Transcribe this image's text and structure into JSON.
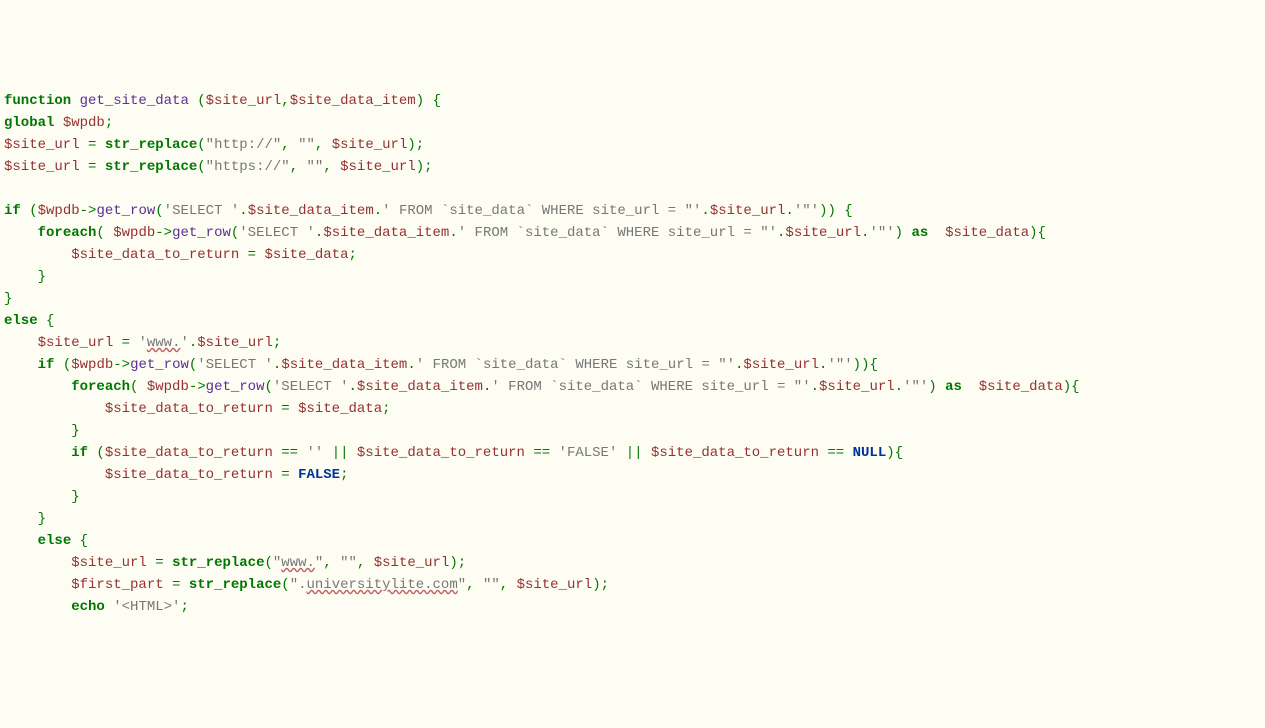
{
  "l1": {
    "kw1": "function",
    "func": "get_site_data",
    "p": " (",
    "v1": "$site_url",
    "c": ",",
    "v2": "$site_data_item",
    "end": ") {"
  },
  "l2": {
    "kw": "global",
    "sp": " ",
    "v": "$wpdb",
    "end": ";"
  },
  "l3": {
    "v1": "$site_url",
    "eq": " = ",
    "fn": "str_replace",
    "p1": "(",
    "s1": "\"http://\"",
    "c1": ", ",
    "s2": "\"\"",
    "c2": ", ",
    "v2": "$site_url",
    "end": ");"
  },
  "l4": {
    "v1": "$site_url",
    "eq": " = ",
    "fn": "str_replace",
    "p1": "(",
    "s1": "\"https://\"",
    "c1": ", ",
    "s2": "\"\"",
    "c2": ", ",
    "v2": "$site_url",
    "end": ");"
  },
  "l6": {
    "kw": "if",
    "sp": " (",
    "v1": "$wpdb",
    "arrow": "->",
    "m": "get_row",
    "p1": "(",
    "s1": "'SELECT '",
    "d1": ".",
    "v2": "$site_data_item",
    "d2": ".",
    "s2": "' FROM `site_data` WHERE site_url = \"'",
    "d3": ".",
    "v3": "$site_url",
    "d4": ".",
    "s3": "'\"'",
    "end": ")) {"
  },
  "l7": {
    "kw": "foreach",
    "p1": "( ",
    "v1": "$wpdb",
    "arrow": "->",
    "m": "get_row",
    "p2": "(",
    "s1": "'SELECT '",
    "d1": ".",
    "v2": "$site_data_item",
    "d2": ".",
    "s2": "' FROM `site_data` WHERE site_url = \"'",
    "d3": ".",
    "v3": "$site_url",
    "d4": ".",
    "s3": "'\"'",
    "p3": ") ",
    "kw2": "as",
    "sp": "  ",
    "v4": "$site_data",
    "end": "){"
  },
  "l8": {
    "v1": "$site_data_to_return",
    "eq": " = ",
    "v2": "$site_data",
    "end": ";"
  },
  "l9": {
    "b": "}"
  },
  "l10": {
    "b": "}"
  },
  "l11": {
    "kw": "else",
    "b": " {"
  },
  "l12": {
    "v1": "$site_url",
    "eq": " = ",
    "s1": "'",
    "s2": "www.",
    "s3": "'",
    "d": ".",
    "v2": "$site_url",
    "end": ";"
  },
  "l13": {
    "kw": "if",
    "sp": " (",
    "v1": "$wpdb",
    "arrow": "->",
    "m": "get_row",
    "p1": "(",
    "s1": "'SELECT '",
    "d1": ".",
    "v2": "$site_data_item",
    "d2": ".",
    "s2": "' FROM `site_data` WHERE site_url = \"'",
    "d3": ".",
    "v3": "$site_url",
    "d4": ".",
    "s3": "'\"'",
    "end": ")){"
  },
  "l14": {
    "kw": "foreach",
    "p1": "( ",
    "v1": "$wpdb",
    "arrow": "->",
    "m": "get_row",
    "p2": "(",
    "s1": "'SELECT '",
    "d1": ".",
    "v2": "$site_data_item",
    "d2": ".",
    "s2": "' FROM `site_data` WHERE site_url = \"'",
    "d3": ".",
    "v3": "$site_url",
    "d4": ".",
    "s3": "'\"'",
    "p3": ") ",
    "kw2": "as",
    "sp": "  ",
    "v4": "$site_data",
    "end": "){"
  },
  "l15": {
    "v1": "$site_data_to_return",
    "eq": " = ",
    "v2": "$site_data",
    "end": ";"
  },
  "l16": {
    "b": "}"
  },
  "l17": {
    "kw": "if",
    "sp": " (",
    "v1": "$site_data_to_return",
    "op1": " == ",
    "s1": "''",
    "op2": " || ",
    "v2": "$site_data_to_return",
    "op3": " == ",
    "s2": "'FALSE'",
    "op4": " || ",
    "v3": "$site_data_to_return",
    "op5": " == ",
    "c": "NULL",
    "end": "){"
  },
  "l18": {
    "v1": "$site_data_to_return",
    "eq": " = ",
    "c": "FALSE",
    "end": ";"
  },
  "l19": {
    "b": "}"
  },
  "l20": {
    "b": "}"
  },
  "l21": {
    "kw": "else",
    "b": " {"
  },
  "l22": {
    "v1": "$site_url",
    "eq": " = ",
    "fn": "str_replace",
    "p1": "(",
    "s1a": "\"",
    "s1b": "www.",
    "s1c": "\"",
    "c1": ", ",
    "s2": "\"\"",
    "c2": ", ",
    "v2": "$site_url",
    "end": ");"
  },
  "l23": {
    "v1": "$first_part",
    "eq": " = ",
    "fn": "str_replace",
    "p1": "(",
    "s1a": "\".",
    "s1b": "universitylite.com",
    "s1c": "\"",
    "c1": ", ",
    "s2": "\"\"",
    "c2": ", ",
    "v2": "$site_url",
    "end": ");"
  },
  "l24": {
    "kw": "echo",
    "sp": " ",
    "s": "'<HTML>'",
    "end": ";"
  }
}
